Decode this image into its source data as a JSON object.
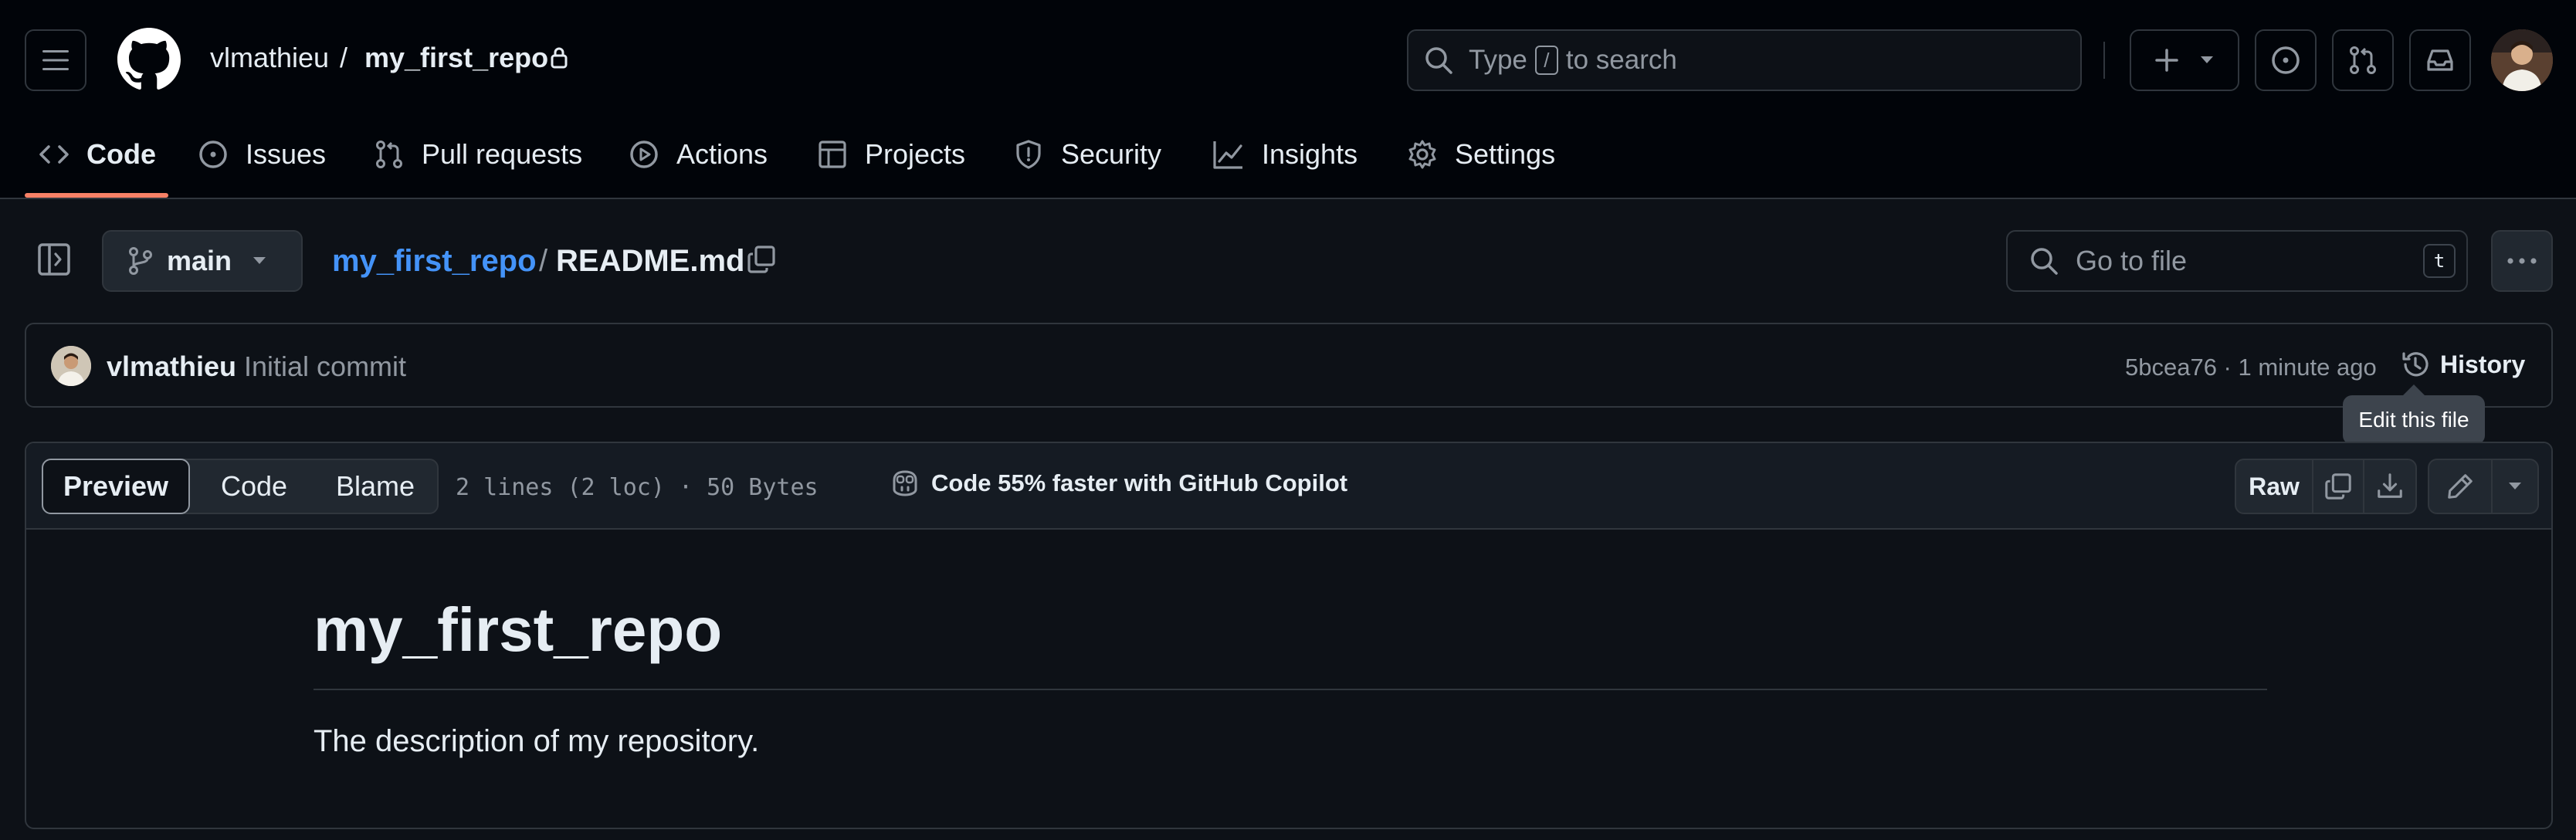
{
  "header": {
    "owner": "vlmathieu",
    "slash": "/",
    "repo": "my_first_repo",
    "search_prefix": "Type",
    "search_key": "/",
    "search_suffix": "to search"
  },
  "repo_nav": {
    "tabs": [
      {
        "label": "Code",
        "icon": "code-icon",
        "active": true
      },
      {
        "label": "Issues",
        "icon": "issue-icon"
      },
      {
        "label": "Pull requests",
        "icon": "pull-request-icon"
      },
      {
        "label": "Actions",
        "icon": "play-icon"
      },
      {
        "label": "Projects",
        "icon": "table-icon"
      },
      {
        "label": "Security",
        "icon": "shield-icon"
      },
      {
        "label": "Insights",
        "icon": "graph-icon"
      },
      {
        "label": "Settings",
        "icon": "gear-icon"
      }
    ]
  },
  "file_header": {
    "branch": "main",
    "repo_link": "my_first_repo",
    "sep": "/",
    "filename": "README.md",
    "goto_placeholder": "Go to file",
    "goto_key": "t"
  },
  "commit": {
    "author": "vlmathieu",
    "message": "Initial commit",
    "meta": "5bcea76 · 1 minute ago",
    "history_label": "History"
  },
  "tooltip": {
    "text": "Edit this file"
  },
  "file_toolbar": {
    "tabs": [
      "Preview",
      "Code",
      "Blame"
    ],
    "stats": "2 lines (2 loc) · 50 Bytes",
    "copilot": "Code 55% faster with GitHub Copilot",
    "raw_label": "Raw"
  },
  "readme": {
    "title": "my_first_repo",
    "description": "The description of my repository."
  },
  "colors": {
    "background": "#0d1117",
    "header_bg": "#010409",
    "border": "#30363d",
    "link": "#4493f8",
    "active_tab_underline": "#f78166",
    "muted_text": "#9198a1"
  }
}
